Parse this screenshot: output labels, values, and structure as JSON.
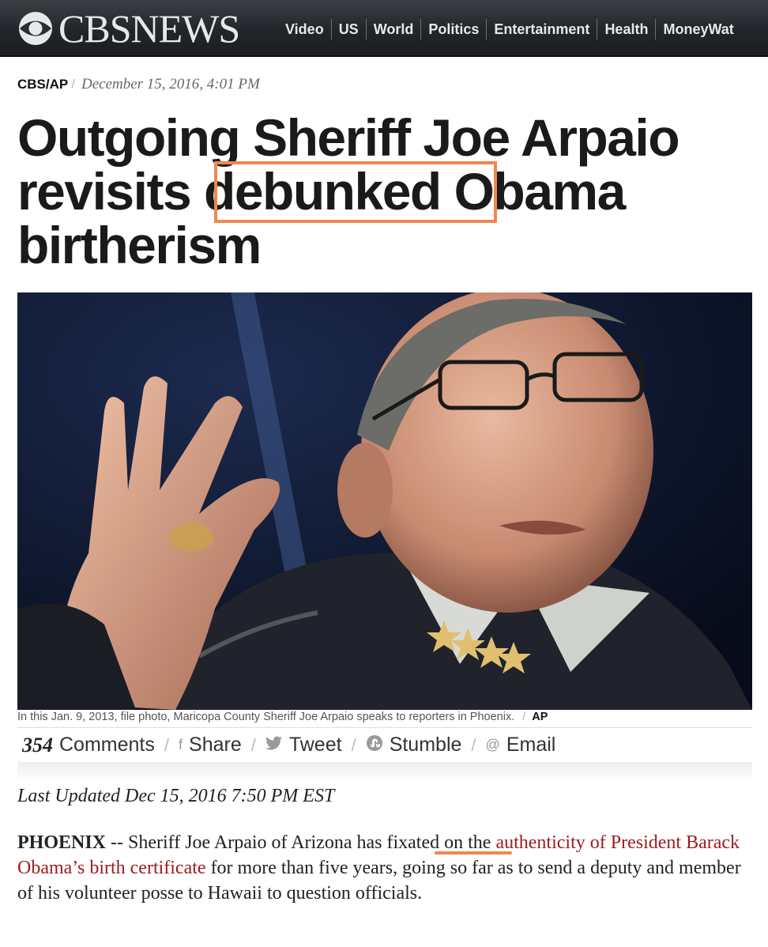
{
  "nav": {
    "logo": "CBSNEWS",
    "items": [
      "Video",
      "US",
      "World",
      "Politics",
      "Entertainment",
      "Health",
      "MoneyWat"
    ]
  },
  "byline": {
    "source": "CBS/AP",
    "separator": "/",
    "date": "December 15, 2016, 4:01 PM"
  },
  "headline": {
    "line1": "Outgoing Sheriff Joe Arpaio",
    "line2_a": "revisits",
    "line2_highlight": "debunked",
    "line2_b": "Obama",
    "line3": "birtherism"
  },
  "photo": {
    "caption": "In this Jan. 9, 2013, file photo, Maricopa County Sheriff Joe Arpaio speaks to reporters in Phoenix.",
    "credit": "AP"
  },
  "share": {
    "comment_count": "354",
    "comments_label": "Comments",
    "share_label": "Share",
    "tweet_label": "Tweet",
    "stumble_label": "Stumble",
    "email_label": "Email"
  },
  "article": {
    "updated": "Last Updated Dec 15, 2016 7:50 PM EST",
    "dateline": "PHOENIX",
    "text_1": " -- Sheriff Joe Arpaio of Arizona has ",
    "highlight_word": "fixated",
    "text_2": " on the ",
    "link_text": "authenticity of President Barack Obama’s birth certificate",
    "text_3": " for more than five years, going so far as to send a deputy and member of his volunteer posse to Hawaii to question officials."
  },
  "colors": {
    "annotation": "#f0874f",
    "link": "#9b1d1d",
    "nav_bg": "#2a2e32"
  }
}
